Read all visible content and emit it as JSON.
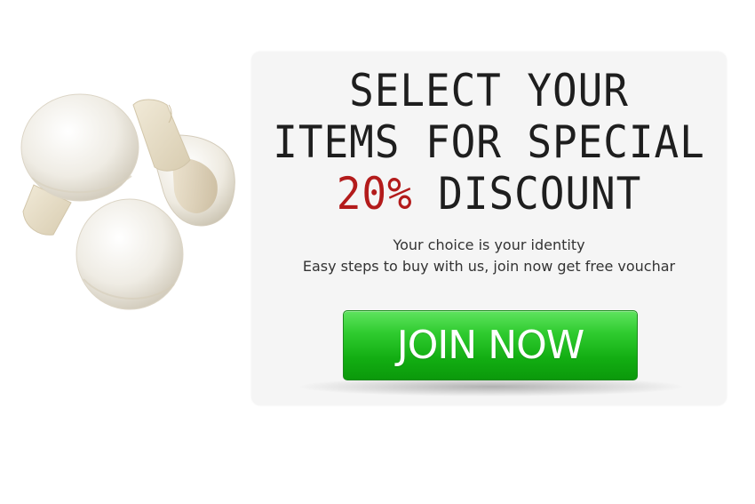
{
  "promo": {
    "headline": {
      "line1": "SELECT YOUR",
      "line2": "ITEMS FOR SPECIAL",
      "discount": "20%",
      "discount_suffix": " DISCOUNT"
    },
    "subtext": {
      "line1": "Your choice is your identity",
      "line2": "Easy steps to buy with us, join now get free vouchar"
    },
    "join_button_label": "JOIN NOW"
  },
  "colors": {
    "highlight": "#b31b1b",
    "button_green": "#12ad12",
    "card_background": "#f5f5f5"
  },
  "image": {
    "icon": "mushroom-icon"
  }
}
